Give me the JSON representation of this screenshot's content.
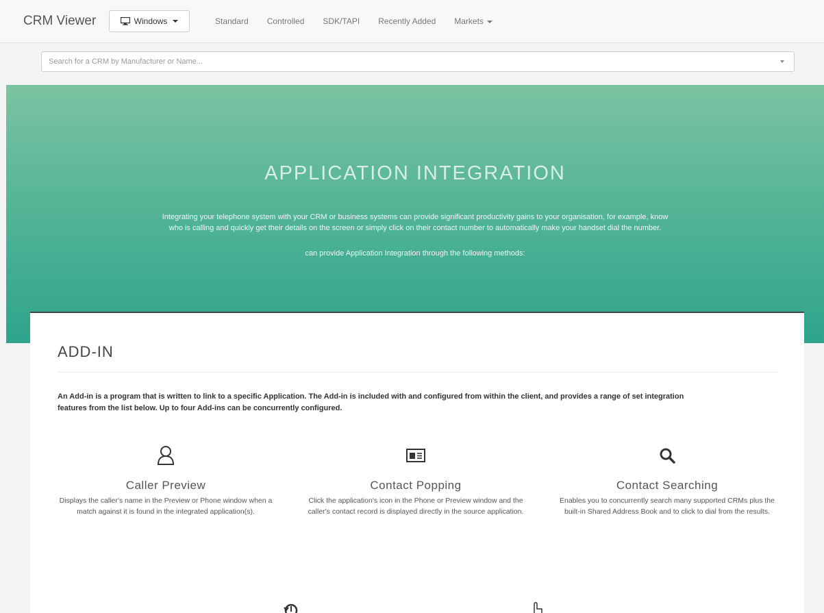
{
  "navbar": {
    "brand": "CRM Viewer",
    "os_dropdown_label": "Windows",
    "links": [
      {
        "label": "Standard"
      },
      {
        "label": "Controlled"
      },
      {
        "label": "SDK/TAPI"
      },
      {
        "label": "Recently Added"
      },
      {
        "label": "Markets"
      }
    ]
  },
  "search": {
    "placeholder": "Search for a CRM by Manufacturer or Name..."
  },
  "hero": {
    "title": "APPLICATION INTEGRATION",
    "description": "Integrating your telephone system with your CRM or business systems can provide significant productivity gains to your organisation, for example, know who is calling and quickly get their details on the screen or simply click on their contact number to automatically make your handset dial the number.",
    "subtitle": "can provide Application Integration through the following methods:"
  },
  "addin": {
    "title": "ADD-IN",
    "description": "An Add-in is a program that is written to link to a specific Application. The Add-in is included with and configured from within the client, and provides a range of set integration features from the list below. Up to four Add-ins can be concurrently configured."
  },
  "features": [
    {
      "icon": "user-icon",
      "title": "Caller Preview",
      "description": "Displays the caller's name in the Preview or Phone window when a match against it is found in the integrated application(s)."
    },
    {
      "icon": "contact-card-icon",
      "title": "Contact Popping",
      "description": "Click the application's icon in the Phone or Preview window and the caller's contact record is displayed directly in the source application."
    },
    {
      "icon": "search-icon",
      "title": "Contact Searching",
      "description": "Enables you to concurrently search many supported CRMs plus the built-in Shared Address Book and to click to dial from the results."
    }
  ],
  "colors": {
    "hero_top": "#7cc3a3",
    "hero_bottom": "#2ea48c",
    "panel_border": "#444444"
  }
}
